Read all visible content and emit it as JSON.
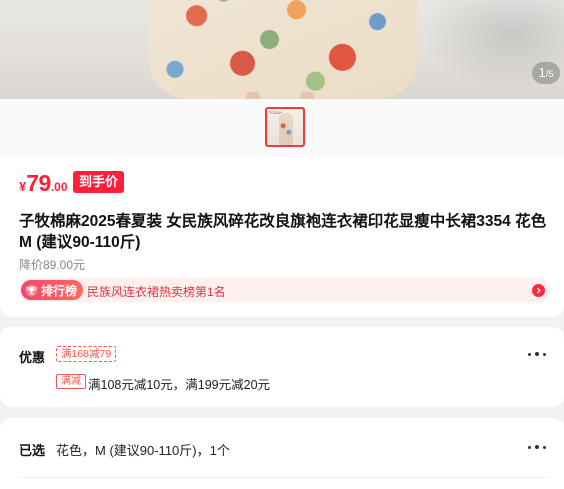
{
  "gallery": {
    "current": "1",
    "separator": "/",
    "total": "5",
    "thumb_label": "TODAY"
  },
  "product": {
    "price_currency": "¥",
    "price_integer": "79",
    "price_decimal": ".00",
    "price_badge": "到手价",
    "title": "子牧棉麻2025春夏装 女民族风碎花改良旗袍连衣裙印花显瘦中长裙3354 花色 M (建议90-110斤)",
    "original_price": "降价89.00元",
    "rank_tag": "排行榜",
    "rank_text": "民族风连衣裙热卖榜第1名"
  },
  "discount": {
    "label": "优惠",
    "coupon": "满168减79",
    "promo_tag": "满减",
    "promo_text": "满108元减10元，满199元减20元"
  },
  "selection": {
    "label": "已选",
    "value": "花色，M (建议90-110斤)，1个"
  },
  "colors": {
    "accent": "#ff1f3a",
    "rank_bg": "#fff0f0",
    "page_bg": "#f2f2f2"
  }
}
